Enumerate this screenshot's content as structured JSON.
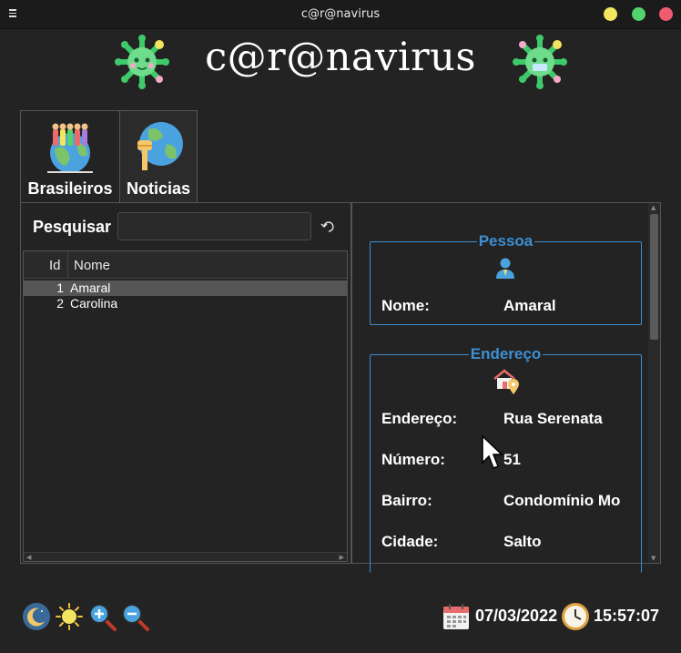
{
  "window": {
    "title": "c@r@navirus"
  },
  "header": {
    "app_title": "c@r@navirus"
  },
  "tabs": [
    {
      "label": "Brasileiros",
      "icon": "crowd-globe-icon",
      "active": true
    },
    {
      "label": "Noticias",
      "icon": "news-globe-icon",
      "active": false
    }
  ],
  "search": {
    "label": "Pesquisar",
    "value": "",
    "placeholder": ""
  },
  "table": {
    "columns": [
      "Id",
      "Nome"
    ],
    "rows": [
      {
        "id": "1",
        "name": "Amaral",
        "selected": true
      },
      {
        "id": "2",
        "name": "Carolina",
        "selected": false
      }
    ]
  },
  "pessoa": {
    "title": "Pessoa",
    "icon": "person-icon",
    "fields": [
      {
        "label": "Nome:",
        "value": "Amaral"
      }
    ]
  },
  "endereco": {
    "title": "Endereço",
    "icon": "house-location-icon",
    "fields": [
      {
        "label": "Endereço:",
        "value": "Rua Serenata"
      },
      {
        "label": "Número:",
        "value": "51"
      },
      {
        "label": "Bairro:",
        "value": "Condomínio Mo"
      },
      {
        "label": "Cidade:",
        "value": "Salto"
      }
    ]
  },
  "footer": {
    "date": "07/03/2022",
    "time": "15:57:07",
    "icons": [
      "moon-icon",
      "sun-icon",
      "zoom-in-icon",
      "zoom-out-icon",
      "calendar-icon",
      "clock-icon"
    ]
  },
  "colors": {
    "background": "#232323",
    "accent": "#3d8fd1",
    "virus_green": "#3ec96a",
    "text": "#ffffff"
  }
}
